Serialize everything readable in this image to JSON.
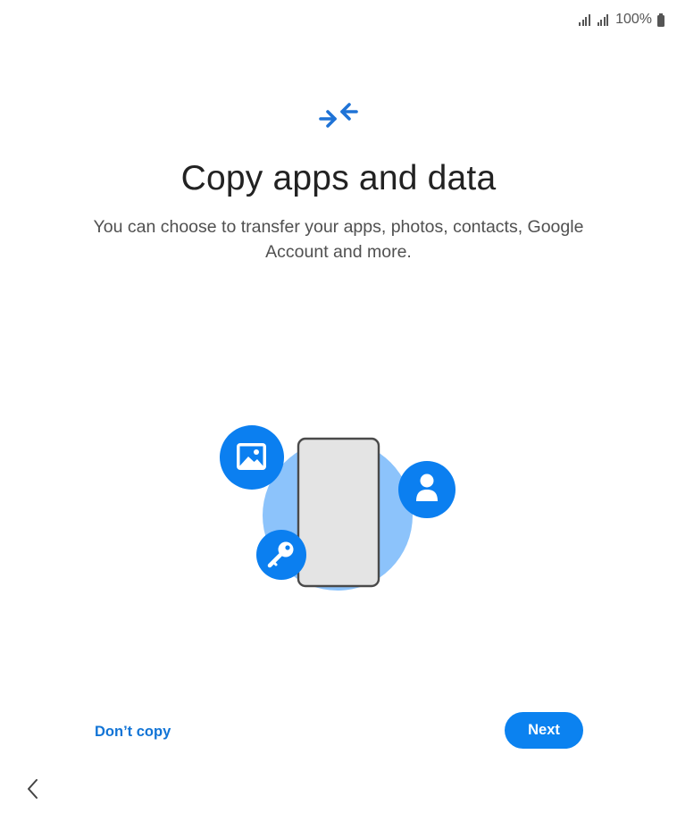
{
  "status_bar": {
    "battery_text": "100%",
    "icons": [
      "signal-icon",
      "signal-icon",
      "battery-icon"
    ]
  },
  "header": {
    "icon": "transfer-arrows-icon",
    "title": "Copy apps and data",
    "subtitle": "You can choose to transfer your apps, photos, contacts, Google Account and more."
  },
  "illustration": {
    "icons": [
      "image-icon",
      "key-icon",
      "person-icon",
      "phone-icon"
    ]
  },
  "actions": {
    "dont_copy_label": "Don’t copy",
    "next_label": "Next"
  },
  "navigation": {
    "back_icon": "chevron-left-icon"
  },
  "colors": {
    "accent": "#0b82f0",
    "link": "#1174d6",
    "illustration_circle": "#8cc3fb",
    "badge": "#0b7ff0",
    "phone_fill": "#e4e4e4",
    "phone_border": "#4a4a4a"
  }
}
